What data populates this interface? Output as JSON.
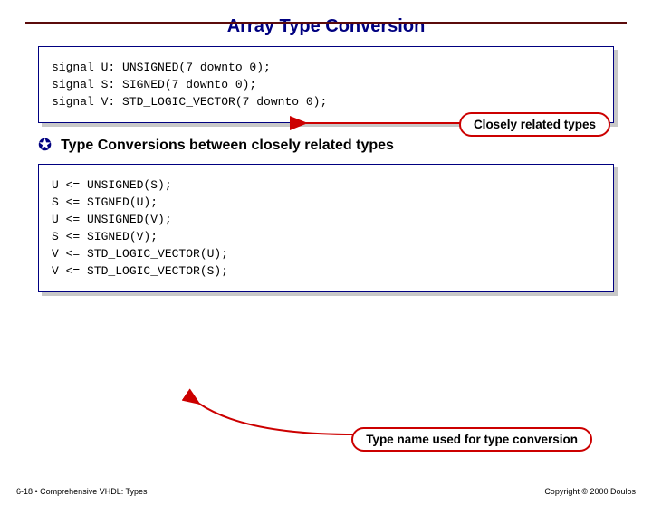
{
  "title": "Array Type Conversion",
  "box1": {
    "lines": [
      "signal U: UNSIGNED(7 downto 0);",
      "signal S: SIGNED(7 downto 0);",
      "signal V: STD_LOGIC_VECTOR(7 downto 0);"
    ]
  },
  "callout1": "Closely related types",
  "bullet1": "Type Conversions between closely related types",
  "box2": {
    "lines": [
      "U <= UNSIGNED(S);",
      "S <= SIGNED(U);",
      "U <= UNSIGNED(V);",
      "S <= SIGNED(V);",
      "V <= STD_LOGIC_VECTOR(U);",
      "V <= STD_LOGIC_VECTOR(S);"
    ]
  },
  "callout2": "Type name used for type conversion",
  "footer": {
    "left": "6-18  •  Comprehensive VHDL: Types",
    "right": "Copyright © 2000 Doulos"
  }
}
